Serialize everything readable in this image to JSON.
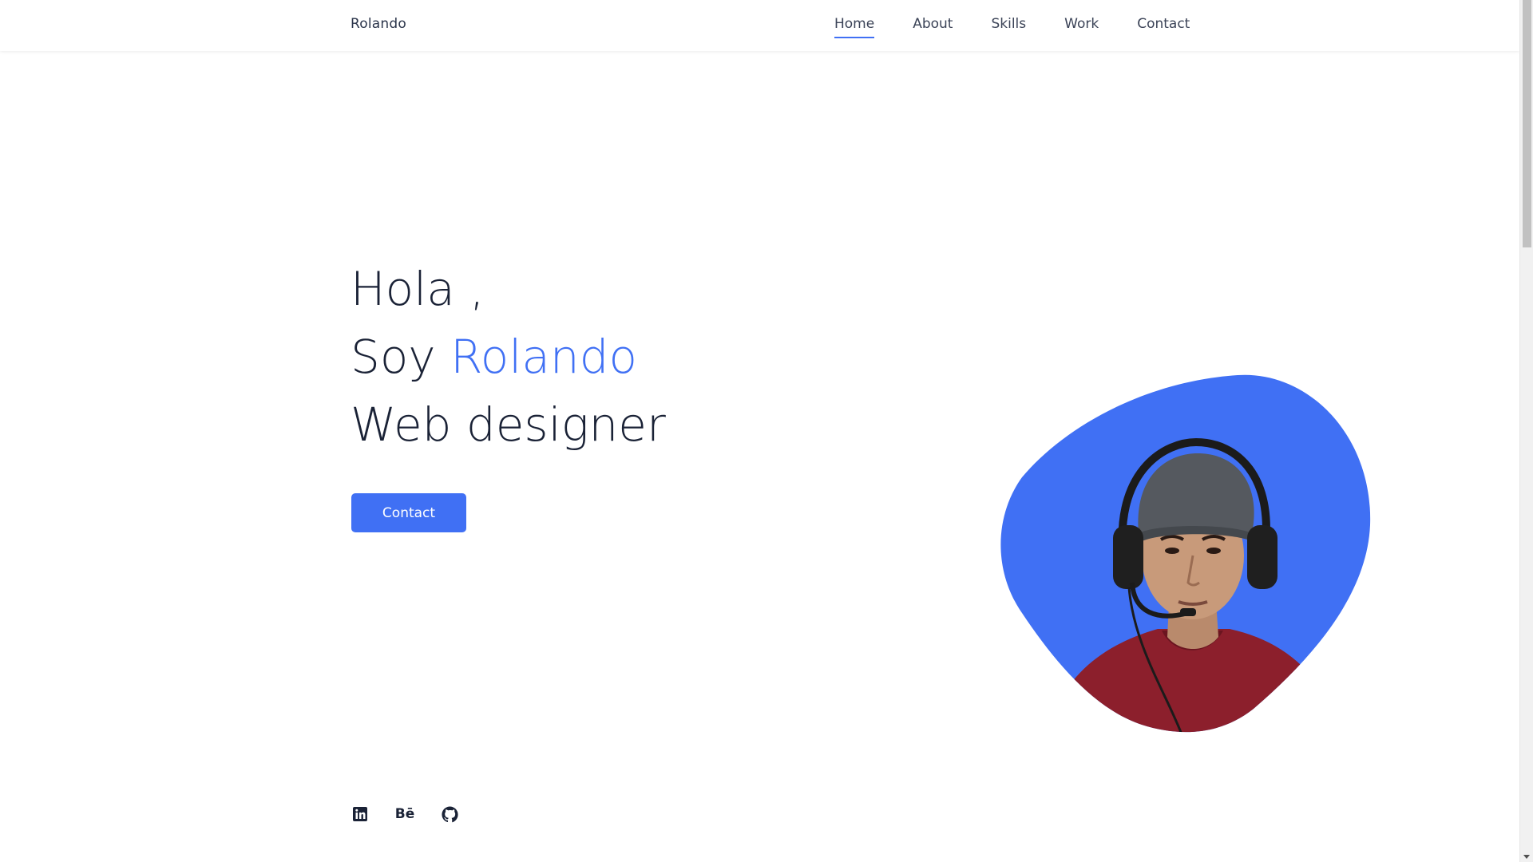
{
  "header": {
    "logo": "Rolando",
    "nav": [
      {
        "label": "Home",
        "active": true
      },
      {
        "label": "About",
        "active": false
      },
      {
        "label": "Skills",
        "active": false
      },
      {
        "label": "Work",
        "active": false
      },
      {
        "label": "Contact",
        "active": false
      }
    ]
  },
  "hero": {
    "greeting": "Hola ,",
    "intro_prefix": "Soy ",
    "name": "Rolando",
    "role": "Web designer",
    "contact_button": "Contact"
  },
  "portrait": {
    "blob_color": "#4070f4"
  },
  "social": {
    "icons": [
      "linkedin-icon",
      "behance-icon",
      "github-icon"
    ],
    "behance_label": "Bē"
  },
  "colors": {
    "accent": "#4070f4",
    "text": "#1a2236"
  }
}
